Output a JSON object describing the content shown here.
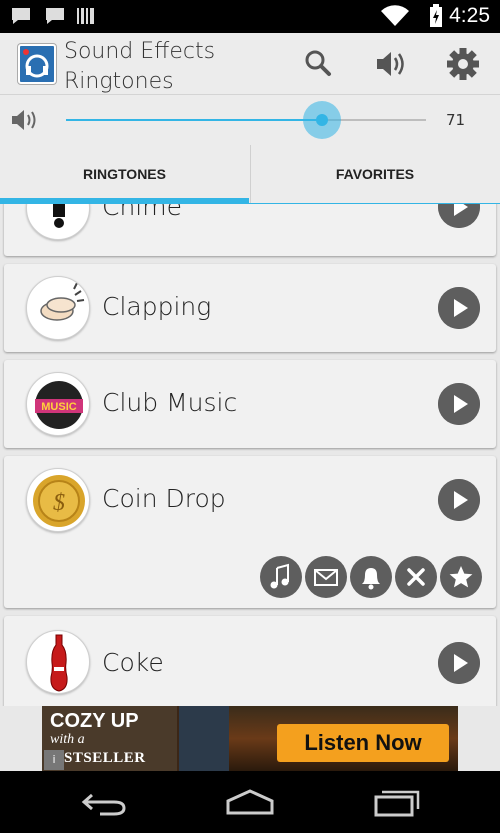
{
  "status_bar": {
    "time": "4:25",
    "icons": [
      "chat-icon",
      "chat-icon",
      "barcode-icon",
      "wifi-icon",
      "battery-charging-icon"
    ]
  },
  "action_bar": {
    "title_line1": "Sound Effects",
    "title_line2": "Ringtones",
    "actions": [
      "search-icon",
      "volume-icon",
      "settings-gear-icon"
    ]
  },
  "volume": {
    "value_label": "71",
    "level_fraction": 0.71,
    "accent_color": "#33b5e5"
  },
  "tabs": [
    {
      "label": "RINGTONES",
      "selected": true
    },
    {
      "label": "FAVORITES",
      "selected": false
    }
  ],
  "list": {
    "items": [
      {
        "label": "Chime",
        "thumb": "chime-bell-icon"
      },
      {
        "label": "Clapping",
        "thumb": "clapping-hands-icon"
      },
      {
        "label": "Club Music",
        "thumb": "club-music-logo-icon"
      },
      {
        "label": "Coin Drop",
        "thumb": "gold-coin-icon",
        "expanded": true,
        "actions": [
          "ringtone-music-note-icon",
          "notification-envelope-icon",
          "alarm-bell-icon",
          "remove-x-icon",
          "favorite-star-icon"
        ]
      },
      {
        "label": "Coke",
        "thumb": "soda-bottle-icon"
      }
    ]
  },
  "ad": {
    "line1": "COZY UP",
    "line2": "with a",
    "line3": "STSELLER",
    "cta": "Listen Now"
  },
  "navbar": {
    "buttons": [
      "back-icon",
      "home-icon",
      "recent-apps-icon"
    ]
  }
}
